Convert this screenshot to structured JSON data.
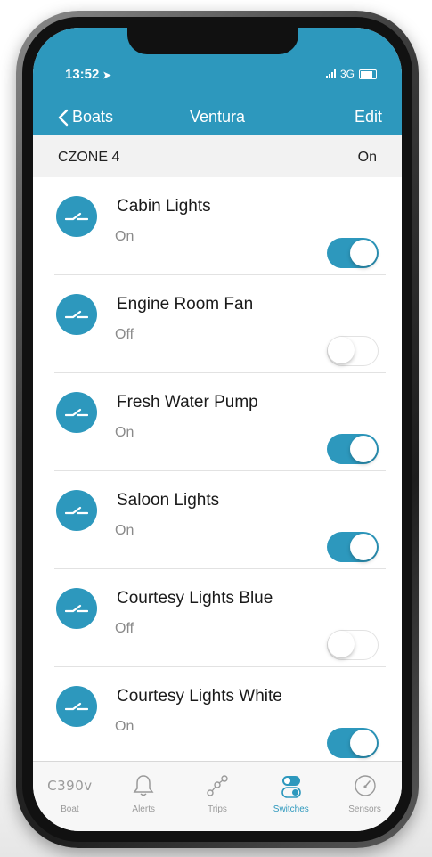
{
  "colors": {
    "accent": "#2d98bd",
    "toggle_off_border": "#e2e2e2"
  },
  "status_bar": {
    "time": "13:52",
    "network": "3G"
  },
  "nav": {
    "back_label": "Boats",
    "title": "Ventura",
    "edit_label": "Edit"
  },
  "section": {
    "title": "CZONE 4",
    "status": "On"
  },
  "switches": [
    {
      "name": "Cabin Lights",
      "state": "On",
      "on": true
    },
    {
      "name": "Engine Room Fan",
      "state": "Off",
      "on": false
    },
    {
      "name": "Fresh Water Pump",
      "state": "On",
      "on": true
    },
    {
      "name": "Saloon Lights",
      "state": "On",
      "on": true
    },
    {
      "name": "Courtesy Lights Blue",
      "state": "Off",
      "on": false
    },
    {
      "name": "Courtesy Lights White",
      "state": "On",
      "on": true
    }
  ],
  "tabs": [
    {
      "label": "Boat",
      "icon": "boat-model-icon",
      "icon_text": "C390v",
      "active": false
    },
    {
      "label": "Alerts",
      "icon": "bell-icon",
      "active": false
    },
    {
      "label": "Trips",
      "icon": "route-icon",
      "active": false
    },
    {
      "label": "Switches",
      "icon": "switches-icon",
      "active": true
    },
    {
      "label": "Sensors",
      "icon": "gauge-icon",
      "active": false
    }
  ]
}
